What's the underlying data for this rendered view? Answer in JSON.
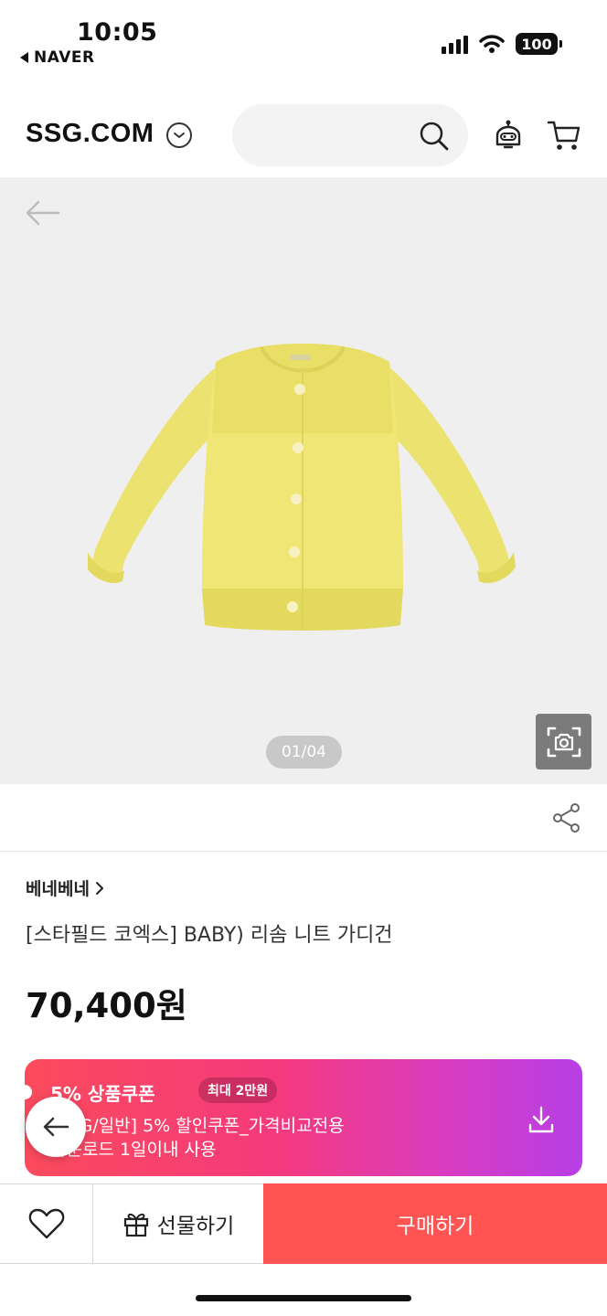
{
  "status_bar": {
    "time": "10:05",
    "back_app": "NAVER",
    "battery": "100"
  },
  "header": {
    "logo": "SSG.COM",
    "search": {
      "placeholder": ""
    },
    "icons": [
      "chevron-down-icon",
      "search-icon",
      "bot-icon",
      "cart-icon"
    ]
  },
  "gallery": {
    "page_indicator": "01/04",
    "icons": [
      "back-arrow-icon",
      "image-search-icon"
    ]
  },
  "product": {
    "brand": "베네베네",
    "name": "[스타필드 코엑스] BABY) 리솜 니트 가디건",
    "price": "70,400원"
  },
  "coupon": {
    "title": "5% 상품쿠폰",
    "badge": "최대 2만원",
    "line1": "[SSG/일반] 5% 할인쿠폰_가격비교전용",
    "line2": "다운로드 1일이내 사용",
    "colors": {
      "start": "#fb4b5c",
      "end": "#b63fe6"
    }
  },
  "actions": {
    "gift_label": "선물하기",
    "buy_label": "구매하기",
    "buy_color": "#ff5452"
  }
}
